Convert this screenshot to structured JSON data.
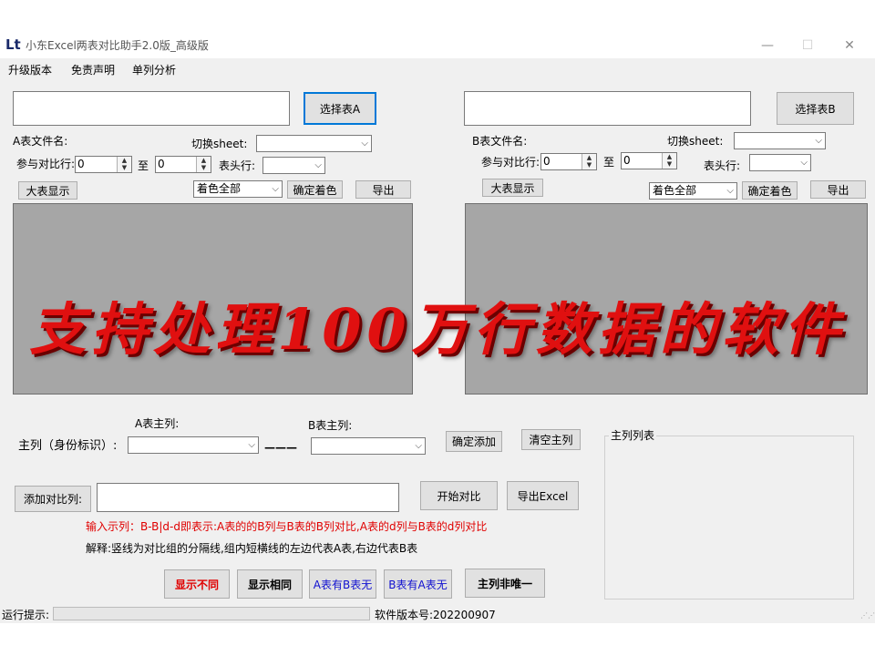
{
  "window": {
    "app_icon": "Lt",
    "title": "小东Excel两表对比助手2.0版_高级版",
    "minimize": "—",
    "maximize": "☐",
    "close": "✕"
  },
  "menu": [
    "升级版本",
    "免责声明",
    "单列分析"
  ],
  "left": {
    "select_button": "选择表A",
    "filename_label": "A表文件名:",
    "switch_sheet_label": "切换sheet:",
    "compare_rows_label": "参与对比行:",
    "from_value": "0",
    "to_label": "至",
    "to_value": "0",
    "header_row_label": "表头行:",
    "big_view_button": "大表显示",
    "color_option": "着色全部",
    "apply_color_button": "确定着色",
    "export_button": "导出"
  },
  "right": {
    "select_button": "选择表B",
    "filename_label": "B表文件名:",
    "switch_sheet_label": "切换sheet:",
    "compare_rows_label": "参与对比行:",
    "from_value": "0",
    "to_label": "至",
    "to_value": "0",
    "header_row_label": "表头行:",
    "big_view_button": "大表显示",
    "color_option": "着色全部",
    "apply_color_button": "确定着色",
    "export_button": "导出"
  },
  "banner": "支持处理100万行数据的软件",
  "key": {
    "a_key_label": "A表主列:",
    "b_key_label": "B表主列:",
    "main_label": "主列（身份标识）:",
    "dash": "———",
    "confirm_add_button": "确定添加",
    "clear_button": "清空主列",
    "list_title": "主列列表"
  },
  "compare": {
    "add_button": "添加对比列:",
    "start_button": "开始对比",
    "export_excel_button": "导出Excel",
    "example_text": "输入示列：B-B|d-d即表示:A表的的B列与B表的B列对比,A表的d列与B表的d列对比",
    "explain_text": "解释:竖线为对比组的分隔线,组内短横线的左边代表A表,右边代表B表"
  },
  "filters": {
    "show_diff": "显示不同",
    "show_same": "显示相同",
    "a_has_b_not": "A表有B表无",
    "b_has_a_not": "B表有A表无",
    "key_not_unique": "主列非唯一"
  },
  "status": {
    "run_label": "运行提示:",
    "version_label": "软件版本号:202200907"
  },
  "colors": {
    "window_bg": "#f0f0f0",
    "grid_bg": "#a6a6a6",
    "banner_red": "#e01010",
    "example_red": "#e00000",
    "link_blue": "#1010d0",
    "focus_blue": "#0078d7"
  }
}
